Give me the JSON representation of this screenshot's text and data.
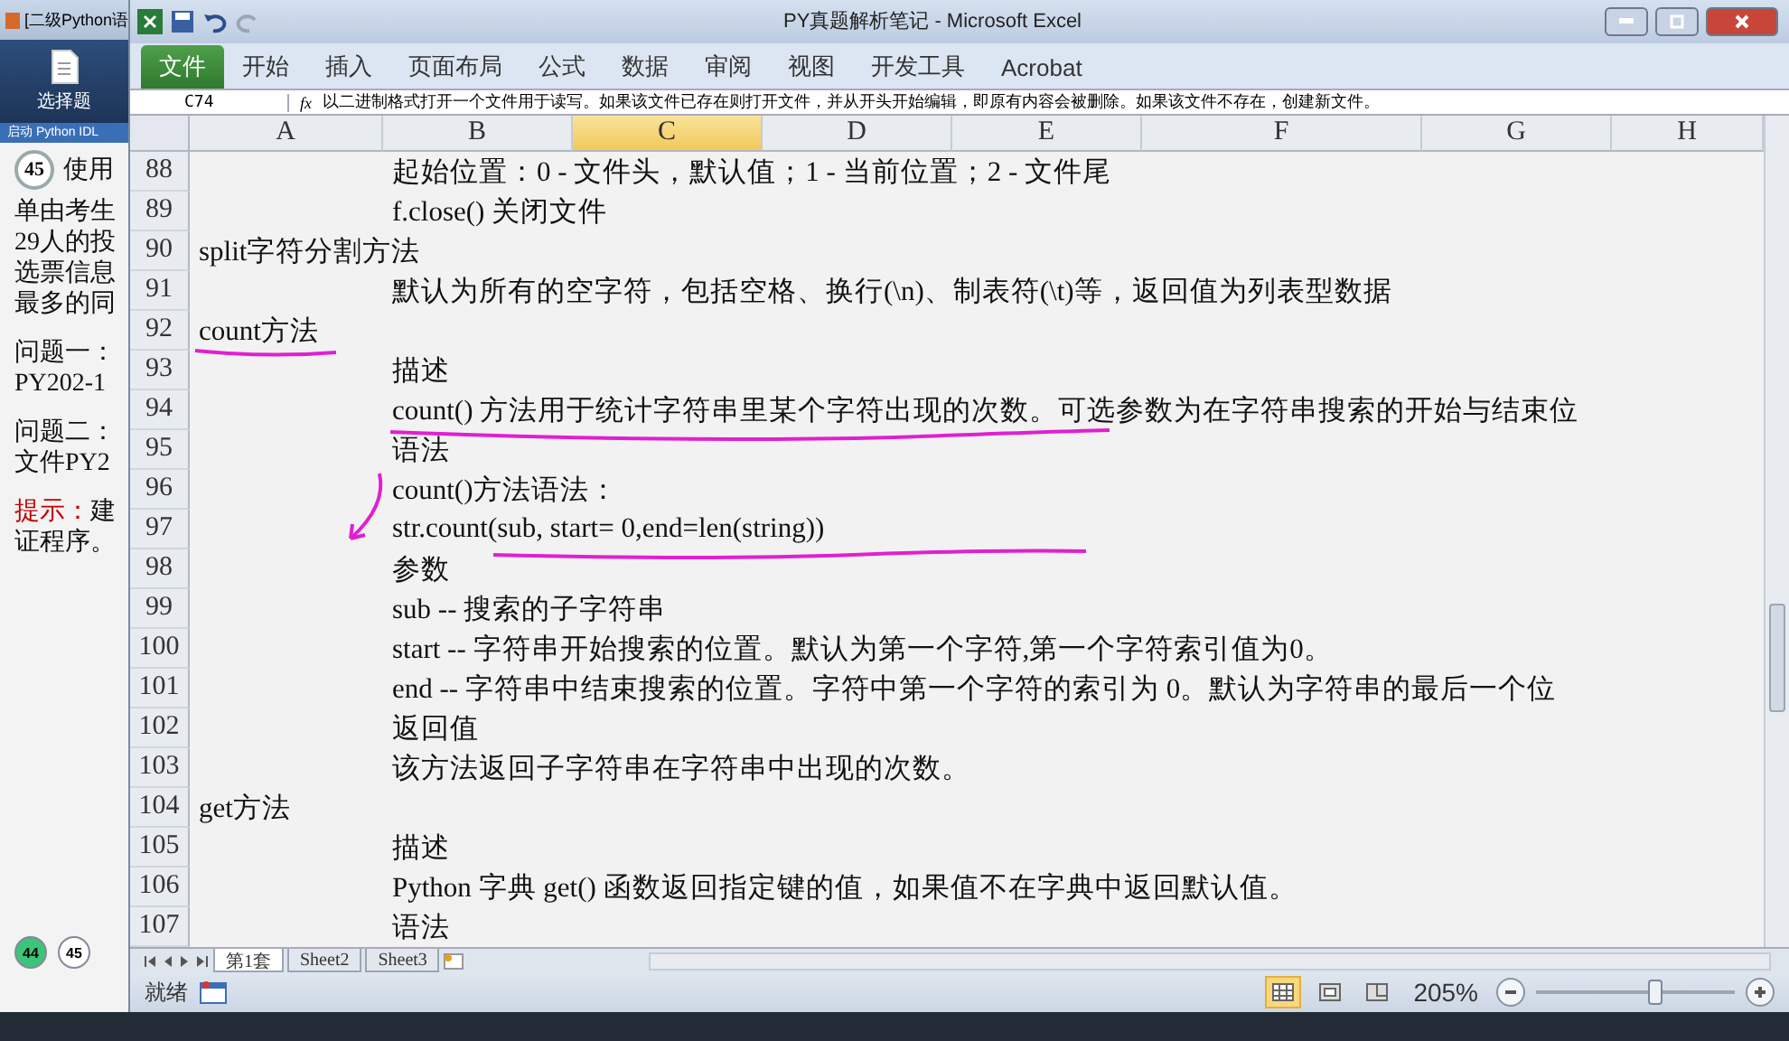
{
  "back_window": {
    "title": "[二级Python语",
    "tool_label": "选择题",
    "launch_bar": "启动 Python IDL",
    "question_number": "45",
    "question_lines": [
      {
        "kind": "heading",
        "text": "使用"
      },
      {
        "kind": "text",
        "text": "单由考生"
      },
      {
        "kind": "text",
        "text": "29人的投"
      },
      {
        "kind": "text",
        "text": "选票信息"
      },
      {
        "kind": "text",
        "text": "最多的同"
      },
      {
        "kind": "gap"
      },
      {
        "kind": "text",
        "text": "问题一："
      },
      {
        "kind": "text",
        "text": "PY202-1"
      },
      {
        "kind": "gap"
      },
      {
        "kind": "text",
        "text": "问题二："
      },
      {
        "kind": "text",
        "text": "文件PY2"
      },
      {
        "kind": "gap"
      },
      {
        "kind": "hint",
        "text": "**提示：**建"
      },
      {
        "kind": "text",
        "text": "证程序。"
      }
    ],
    "pages": [
      {
        "label": "44",
        "selected": true
      },
      {
        "label": "45",
        "selected": false
      }
    ]
  },
  "window": {
    "title": "PY真题解析笔记 - Microsoft Excel"
  },
  "ribbon_tabs": [
    {
      "label": "文件",
      "kind": "file",
      "selected": false
    },
    {
      "label": "开始",
      "kind": "tab",
      "selected": false
    },
    {
      "label": "插入",
      "kind": "tab",
      "selected": false
    },
    {
      "label": "页面布局",
      "kind": "tab",
      "selected": false
    },
    {
      "label": "公式",
      "kind": "tab",
      "selected": false
    },
    {
      "label": "数据",
      "kind": "tab",
      "selected": false
    },
    {
      "label": "审阅",
      "kind": "tab",
      "selected": false
    },
    {
      "label": "视图",
      "kind": "tab",
      "selected": false
    },
    {
      "label": "开发工具",
      "kind": "tab",
      "selected": false
    },
    {
      "label": "Acrobat",
      "kind": "tab",
      "selected": false
    }
  ],
  "formula_bar": {
    "name_box": "C74",
    "function_label": "fx",
    "value": "以二进制格式打开一个文件用于读写。如果该文件已存在则打开文件，并从开头开始编辑，即原有内容会被删除。如果该文件不存在，创建新文件。"
  },
  "columns": [
    {
      "label": "A",
      "selected": false
    },
    {
      "label": "B",
      "selected": false
    },
    {
      "label": "C",
      "selected": true
    },
    {
      "label": "D",
      "selected": false
    },
    {
      "label": "E",
      "selected": false
    },
    {
      "label": "F",
      "selected": false
    },
    {
      "label": "G",
      "selected": false
    },
    {
      "label": "H",
      "selected": false
    }
  ],
  "rows": [
    {
      "number": "88",
      "kind": "detail",
      "text": "起始位置：0 - 文件头，默认值；1 - 当前位置；2 - 文件尾"
    },
    {
      "number": "89",
      "kind": "detail",
      "text": "f.close()  关闭文件"
    },
    {
      "number": "90",
      "kind": "heading",
      "text": "split字符分割方法"
    },
    {
      "number": "91",
      "kind": "detail",
      "text": "默认为所有的空字符，包括空格、换行(\\n)、制表符(\\t)等，返回值为列表型数据"
    },
    {
      "number": "92",
      "kind": "heading",
      "text": "count方法"
    },
    {
      "number": "93",
      "kind": "detail",
      "text": "描述"
    },
    {
      "number": "94",
      "kind": "detail",
      "text": "count() 方法用于统计字符串里某个字符出现的次数。可选参数为在字符串搜索的开始与结束位"
    },
    {
      "number": "95",
      "kind": "detail",
      "text": "语法"
    },
    {
      "number": "96",
      "kind": "detail",
      "text": "count()方法语法："
    },
    {
      "number": "97",
      "kind": "detail",
      "text": "str.count(sub, start= 0,end=len(string))"
    },
    {
      "number": "98",
      "kind": "detail",
      "text": "参数"
    },
    {
      "number": "99",
      "kind": "detail",
      "text": "sub -- 搜索的子字符串"
    },
    {
      "number": "100",
      "kind": "detail",
      "text": "start -- 字符串开始搜索的位置。默认为第一个字符,第一个字符索引值为0。"
    },
    {
      "number": "101",
      "kind": "detail",
      "text": "end -- 字符串中结束搜索的位置。字符中第一个字符的索引为 0。默认为字符串的最后一个位"
    },
    {
      "number": "102",
      "kind": "detail",
      "text": "返回值"
    },
    {
      "number": "103",
      "kind": "detail",
      "text": "该方法返回子字符串在字符串中出现的次数。"
    },
    {
      "number": "104",
      "kind": "heading",
      "text": "get方法"
    },
    {
      "number": "105",
      "kind": "detail",
      "text": "描述"
    },
    {
      "number": "106",
      "kind": "detail",
      "text": "Python 字典 get() 函数返回指定键的值，如果值不在字典中返回默认值。"
    },
    {
      "number": "107",
      "kind": "detail",
      "text": "语法"
    }
  ],
  "sheet_tabs": [
    {
      "label": "第1套",
      "selected": true
    },
    {
      "label": "Sheet2",
      "selected": false
    },
    {
      "label": "Sheet3",
      "selected": false
    }
  ],
  "status_bar": {
    "status": "就绪",
    "views": [
      {
        "kind": "normal",
        "selected": true
      },
      {
        "kind": "layout",
        "selected": false
      },
      {
        "kind": "pagebreak",
        "selected": false
      }
    ],
    "zoom": "205%",
    "zoom_slider": {
      "level": 0.6
    }
  }
}
